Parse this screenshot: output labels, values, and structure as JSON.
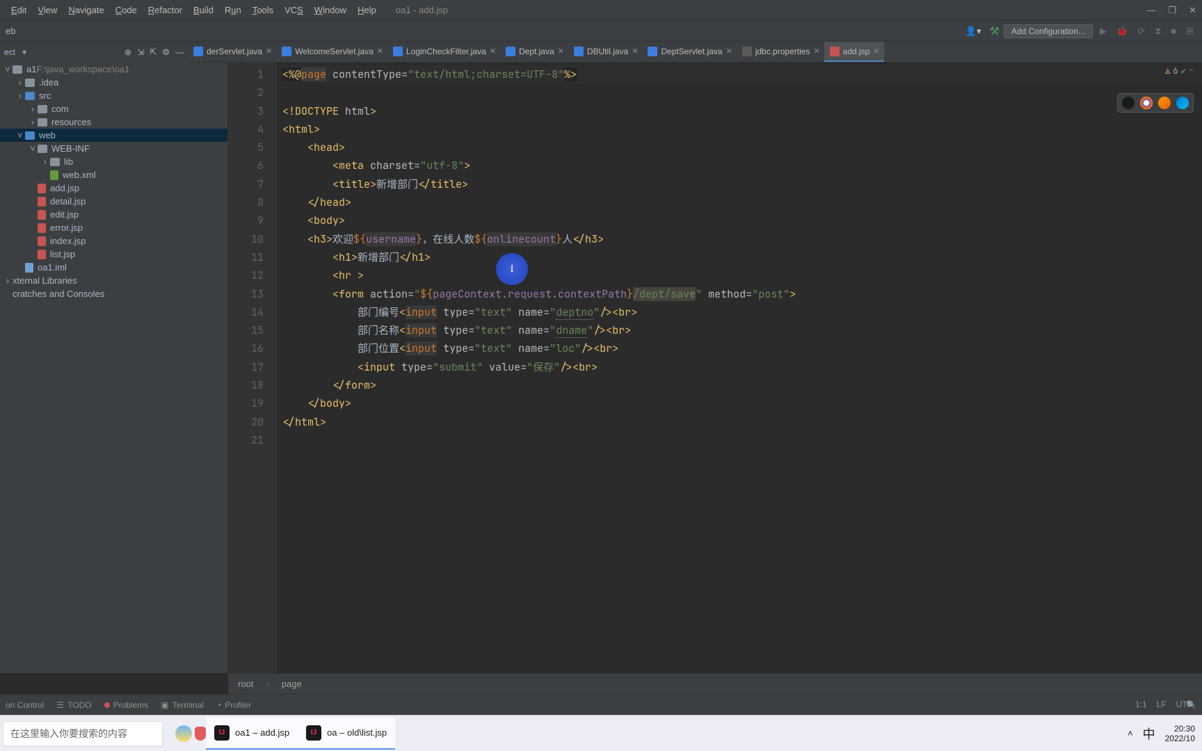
{
  "window_title": "oa1 - add.jsp",
  "menu": [
    "Edit",
    "View",
    "Navigate",
    "Code",
    "Refactor",
    "Build",
    "Run",
    "Tools",
    "VCS",
    "Window",
    "Help"
  ],
  "toolbar": {
    "breadcrumb": "eb",
    "config_label": "Add Configuration..."
  },
  "project_nav": {
    "label": "ect"
  },
  "tabs": [
    {
      "name": "derServlet.java",
      "icon": "java"
    },
    {
      "name": "WelcomeServlet.java",
      "icon": "java"
    },
    {
      "name": "LoginCheckFilter.java",
      "icon": "java"
    },
    {
      "name": "Dept.java",
      "icon": "java"
    },
    {
      "name": "DBUtil.java",
      "icon": "java"
    },
    {
      "name": "DeptServlet.java",
      "icon": "java"
    },
    {
      "name": "jdbc.properties",
      "icon": "props"
    },
    {
      "name": "add.jsp",
      "icon": "jsp",
      "active": true
    }
  ],
  "tree": [
    {
      "indent": 0,
      "chev": "down",
      "icon": "folder",
      "label": "a1",
      "suffix": "F:\\java_workspace\\oa1"
    },
    {
      "indent": 1,
      "chev": "right",
      "icon": "folder",
      "label": ".idea"
    },
    {
      "indent": 1,
      "chev": "right",
      "icon": "folder-blue",
      "label": "src"
    },
    {
      "indent": 2,
      "chev": "right",
      "icon": "folder",
      "label": "com"
    },
    {
      "indent": 2,
      "chev": "right",
      "icon": "folder",
      "label": "resources"
    },
    {
      "indent": 1,
      "chev": "down",
      "icon": "folder-blue",
      "label": "web",
      "sel": true
    },
    {
      "indent": 2,
      "chev": "down",
      "icon": "folder",
      "label": "WEB-INF"
    },
    {
      "indent": 3,
      "chev": "right",
      "icon": "folder",
      "label": "lib"
    },
    {
      "indent": 3,
      "chev": "",
      "icon": "file-xml",
      "label": "web.xml"
    },
    {
      "indent": 2,
      "chev": "",
      "icon": "file",
      "label": "add.jsp"
    },
    {
      "indent": 2,
      "chev": "",
      "icon": "file",
      "label": "detail.jsp"
    },
    {
      "indent": 2,
      "chev": "",
      "icon": "file",
      "label": "edit.jsp"
    },
    {
      "indent": 2,
      "chev": "",
      "icon": "file",
      "label": "error.jsp"
    },
    {
      "indent": 2,
      "chev": "",
      "icon": "file",
      "label": "index.jsp"
    },
    {
      "indent": 2,
      "chev": "",
      "icon": "file",
      "label": "list.jsp"
    },
    {
      "indent": 1,
      "chev": "",
      "icon": "file-iml",
      "label": "oa1.iml"
    },
    {
      "indent": 0,
      "chev": "right",
      "icon": "",
      "label": "xternal Libraries"
    },
    {
      "indent": 0,
      "chev": "",
      "icon": "",
      "label": "cratches and Consoles"
    }
  ],
  "warnings_count": "6",
  "code": {
    "l1_contentType": "text/html;charset=UTF-8",
    "l5_title": "新增部门",
    "l10_a": "欢迎",
    "l10_user": "username",
    "l10_b": "，在线人数",
    "l10_oc": "onlinecount",
    "l10_c": "人",
    "l11_h1": "新增部门",
    "l13_el": "pageContext.request.contextPath",
    "l13_path": "/dept/save",
    "l13_method": "post",
    "l14_lbl": "部门编号",
    "l14_name": "deptno",
    "l15_lbl": "部门名称",
    "l15_name": "dname",
    "l16_lbl": "部门位置",
    "l16_name": "loc",
    "l17_val": "保存"
  },
  "breadcrumb": [
    "root",
    "page"
  ],
  "bottom_tools": {
    "vcs": "on Control",
    "todo": "TODO",
    "problems": "Problems",
    "terminal": "Terminal",
    "profiler": "Profiler"
  },
  "status": {
    "pos": "1:1",
    "le": "LF",
    "enc": "UTF-"
  },
  "taskbar": {
    "search_placeholder": "在这里输入你要搜索的内容",
    "task1": "oa1 – add.jsp",
    "task2": "oa – old\\list.jsp",
    "ime": "中",
    "time": "20:30",
    "date": "2022/10"
  }
}
